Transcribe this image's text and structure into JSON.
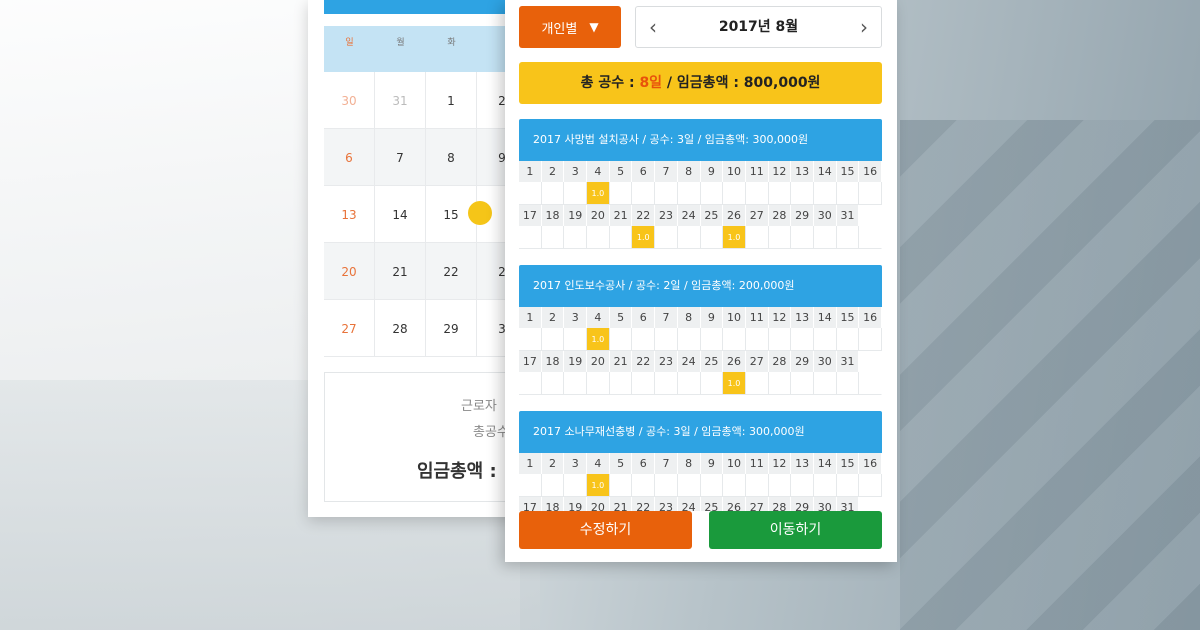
{
  "colors": {
    "orange": "#e8610b",
    "blue": "#2ea3e3",
    "yellow": "#f8c41a",
    "green": "#1a9a3c",
    "accent_red": "#e8520b"
  },
  "back_calendar": {
    "weekdays": [
      "일",
      "월",
      "화"
    ],
    "rows": [
      [
        "30",
        "31",
        "1",
        "2"
      ],
      [
        "6",
        "7",
        "8",
        "9"
      ],
      [
        "13",
        "14",
        "15",
        ""
      ],
      [
        "20",
        "21",
        "22",
        "2"
      ],
      [
        "27",
        "28",
        "29",
        "3"
      ]
    ],
    "summary": {
      "worker": "근로자",
      "total_days": "총공수",
      "total_wage": "임금총액 :"
    }
  },
  "panel": {
    "type_select": {
      "label": "개인별",
      "icon": "triangle-down-icon"
    },
    "month_nav": {
      "label": "2017년 8월",
      "prev_icon": "chevron-left-icon",
      "next_icon": "chevron-right-icon"
    },
    "summary": {
      "prefix": "총 공수 : ",
      "days": "8일",
      "rest": " / 임금총액 : 800,000원"
    },
    "projects": [
      {
        "title": "2017 사망법 설치공사 / 공수: 3일 / 임금총액: 300,000원",
        "first_half_days": [
          "1",
          "2",
          "3",
          "4",
          "5",
          "6",
          "7",
          "8",
          "9",
          "10",
          "11",
          "12",
          "13",
          "14",
          "15",
          "16"
        ],
        "first_half_values": [
          "",
          "",
          "",
          "1.0",
          "",
          "",
          "",
          "",
          "",
          "",
          "",
          "",
          "",
          "",
          "",
          ""
        ],
        "second_half_days": [
          "17",
          "18",
          "19",
          "20",
          "21",
          "22",
          "23",
          "24",
          "25",
          "26",
          "27",
          "28",
          "29",
          "30",
          "31"
        ],
        "second_half_values": [
          "",
          "",
          "",
          "",
          "",
          "1.0",
          "",
          "",
          "",
          "1.0",
          "",
          "",
          "",
          "",
          ""
        ]
      },
      {
        "title": "2017 인도보수공사 / 공수: 2일 / 임금총액: 200,000원",
        "first_half_days": [
          "1",
          "2",
          "3",
          "4",
          "5",
          "6",
          "7",
          "8",
          "9",
          "10",
          "11",
          "12",
          "13",
          "14",
          "15",
          "16"
        ],
        "first_half_values": [
          "",
          "",
          "",
          "1.0",
          "",
          "",
          "",
          "",
          "",
          "",
          "",
          "",
          "",
          "",
          "",
          ""
        ],
        "second_half_days": [
          "17",
          "18",
          "19",
          "20",
          "21",
          "22",
          "23",
          "24",
          "25",
          "26",
          "27",
          "28",
          "29",
          "30",
          "31"
        ],
        "second_half_values": [
          "",
          "",
          "",
          "",
          "",
          "",
          "",
          "",
          "",
          "1.0",
          "",
          "",
          "",
          "",
          ""
        ]
      },
      {
        "title": "2017 소나무재선충병 / 공수: 3일 / 임금총액: 300,000원",
        "first_half_days": [
          "1",
          "2",
          "3",
          "4",
          "5",
          "6",
          "7",
          "8",
          "9",
          "10",
          "11",
          "12",
          "13",
          "14",
          "15",
          "16"
        ],
        "first_half_values": [
          "",
          "",
          "",
          "1.0",
          "",
          "",
          "",
          "",
          "",
          "",
          "",
          "",
          "",
          "",
          "",
          ""
        ],
        "second_half_days": [
          "17",
          "18",
          "19",
          "20",
          "21",
          "22",
          "23",
          "24",
          "25",
          "26",
          "27",
          "28",
          "29",
          "30",
          "31"
        ],
        "second_half_values": [
          "",
          "",
          "",
          "",
          "",
          "",
          "",
          "",
          "",
          "",
          "",
          "",
          "",
          "",
          ""
        ]
      }
    ],
    "edit_button": "수정하기",
    "move_button": "이동하기"
  }
}
